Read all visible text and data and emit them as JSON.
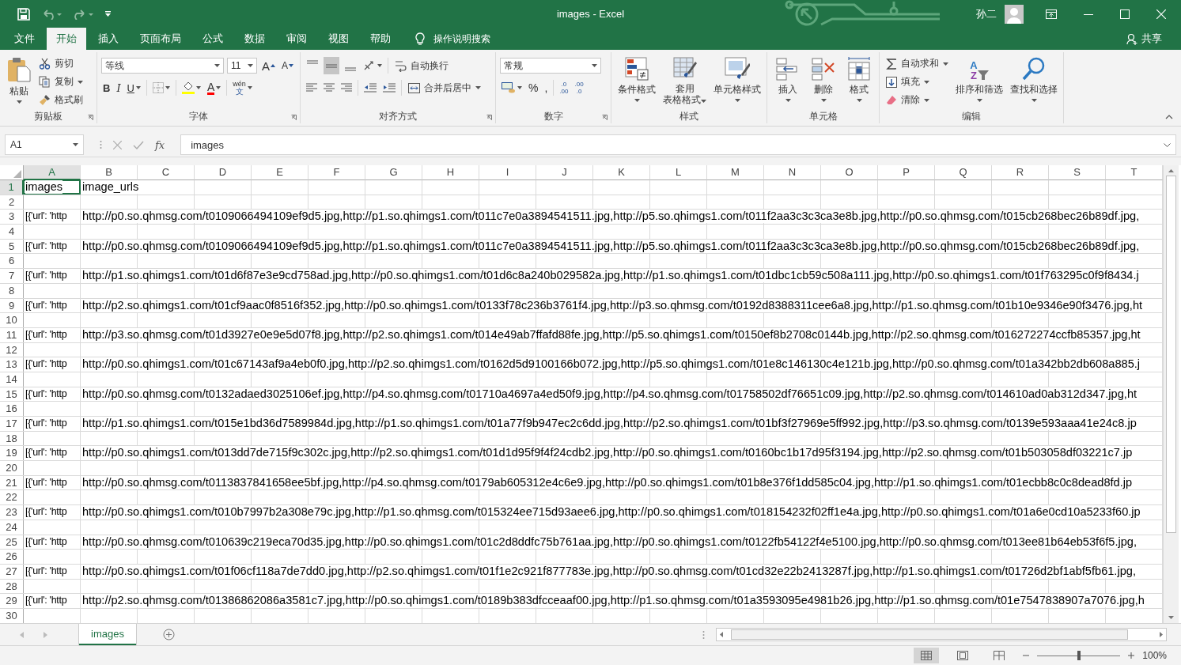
{
  "title_bar": {
    "title": "images  -  Excel",
    "user": "孙二"
  },
  "ribbon_tabs": [
    {
      "label": "文件",
      "selected": false
    },
    {
      "label": "开始",
      "selected": true
    },
    {
      "label": "插入",
      "selected": false
    },
    {
      "label": "页面布局",
      "selected": false
    },
    {
      "label": "公式",
      "selected": false
    },
    {
      "label": "数据",
      "selected": false
    },
    {
      "label": "审阅",
      "selected": false
    },
    {
      "label": "视图",
      "selected": false
    },
    {
      "label": "帮助",
      "selected": false
    }
  ],
  "tell_me": "操作说明搜索",
  "share": "共享",
  "clipboard": {
    "label": "剪贴板",
    "paste": "粘贴",
    "cut": "剪切",
    "copy": "复制",
    "format_painter": "格式刷"
  },
  "font": {
    "label": "字体",
    "font_name": "等线",
    "font_size": "11",
    "grow": "A",
    "shrink": "A",
    "bold": "B",
    "italic": "I",
    "underline": "U",
    "font_color": "A",
    "phonetic_top": "wén",
    "phonetic_bottom": "文"
  },
  "alignment": {
    "label": "对齐方式",
    "wrap_text": "自动换行",
    "merge_center": "合并后居中"
  },
  "number": {
    "label": "数字",
    "format": "常规",
    "percent": "%",
    "comma": ",",
    "increase_decimal": [
      ".0",
      ".00"
    ],
    "decrease_decimal": [
      ".00",
      ".0"
    ]
  },
  "styles": {
    "label": "样式",
    "conditional": "条件格式",
    "table": [
      "套用",
      "表格格式"
    ],
    "cell_styles": "单元格样式"
  },
  "cells": {
    "label": "单元格",
    "buttons": [
      "插入",
      "删除",
      "格式"
    ]
  },
  "editing": {
    "label": "编辑",
    "autosum": "自动求和",
    "fill": "填充",
    "clear": "清除",
    "sort_icon": [
      "A",
      "Z"
    ],
    "sort_filter": "排序和筛选",
    "find_select": "查找和选择"
  },
  "formula_bar": {
    "name_box": "A1",
    "fx": "fx",
    "value": "images"
  },
  "columns": [
    {
      "label": "A",
      "selected": true
    },
    {
      "label": "B",
      "selected": false
    },
    {
      "label": "C",
      "selected": false
    },
    {
      "label": "D",
      "selected": false
    },
    {
      "label": "E",
      "selected": false
    },
    {
      "label": "F",
      "selected": false
    },
    {
      "label": "G",
      "selected": false
    },
    {
      "label": "H",
      "selected": false
    },
    {
      "label": "I",
      "selected": false
    },
    {
      "label": "J",
      "selected": false
    },
    {
      "label": "K",
      "selected": false
    },
    {
      "label": "L",
      "selected": false
    },
    {
      "label": "M",
      "selected": false
    },
    {
      "label": "N",
      "selected": false
    },
    {
      "label": "O",
      "selected": false
    },
    {
      "label": "P",
      "selected": false
    },
    {
      "label": "Q",
      "selected": false
    },
    {
      "label": "R",
      "selected": false
    },
    {
      "label": "S",
      "selected": false
    },
    {
      "label": "T",
      "selected": false
    }
  ],
  "rows": [
    {
      "number": "1",
      "selected": true,
      "cells": [
        "images",
        "image_urls"
      ]
    },
    {
      "number": "2",
      "selected": false,
      "cells": []
    },
    {
      "number": "3",
      "selected": false,
      "cells": [
        "[{'url': 'http",
        "http://p0.so.qhmsg.com/t0109066494109ef9d5.jpg,http://p1.so.qhimgs1.com/t011c7e0a3894541511.jpg,http://p5.so.qhimgs1.com/t011f2aa3c3c3ca3e8b.jpg,http://p0.so.qhmsg.com/t015cb268bec26b89df.jpg,"
      ]
    },
    {
      "number": "4",
      "selected": false,
      "cells": []
    },
    {
      "number": "5",
      "selected": false,
      "cells": [
        "[{'url': 'http",
        "http://p0.so.qhmsg.com/t0109066494109ef9d5.jpg,http://p1.so.qhimgs1.com/t011c7e0a3894541511.jpg,http://p5.so.qhimgs1.com/t011f2aa3c3c3ca3e8b.jpg,http://p0.so.qhmsg.com/t015cb268bec26b89df.jpg,"
      ]
    },
    {
      "number": "6",
      "selected": false,
      "cells": []
    },
    {
      "number": "7",
      "selected": false,
      "cells": [
        "[{'url': 'http",
        "http://p1.so.qhimgs1.com/t01d6f87e3e9cd758ad.jpg,http://p0.so.qhimgs1.com/t01d6c8a240b029582a.jpg,http://p1.so.qhimgs1.com/t01dbc1cb59c508a111.jpg,http://p0.so.qhimgs1.com/t01f763295c0f9f8434.j"
      ]
    },
    {
      "number": "8",
      "selected": false,
      "cells": []
    },
    {
      "number": "9",
      "selected": false,
      "cells": [
        "[{'url': 'http",
        "http://p2.so.qhimgs1.com/t01cf9aac0f8516f352.jpg,http://p0.so.qhimgs1.com/t0133f78c236b3761f4.jpg,http://p3.so.qhmsg.com/t0192d8388311cee6a8.jpg,http://p1.so.qhmsg.com/t01b10e9346e90f3476.jpg,ht"
      ]
    },
    {
      "number": "10",
      "selected": false,
      "cells": []
    },
    {
      "number": "11",
      "selected": false,
      "cells": [
        "[{'url': 'http",
        "http://p3.so.qhmsg.com/t01d3927e0e9e5d07f8.jpg,http://p2.so.qhimgs1.com/t014e49ab7ffafd88fe.jpg,http://p5.so.qhimgs1.com/t0150ef8b2708c0144b.jpg,http://p2.so.qhmsg.com/t016272274ccfb85357.jpg,ht"
      ]
    },
    {
      "number": "12",
      "selected": false,
      "cells": []
    },
    {
      "number": "13",
      "selected": false,
      "cells": [
        "[{'url': 'http",
        "http://p0.so.qhimgs1.com/t01c67143af9a4eb0f0.jpg,http://p2.so.qhimgs1.com/t0162d5d9100166b072.jpg,http://p5.so.qhimgs1.com/t01e8c146130c4e121b.jpg,http://p0.so.qhmsg.com/t01a342bb2db608a885.j"
      ]
    },
    {
      "number": "14",
      "selected": false,
      "cells": []
    },
    {
      "number": "15",
      "selected": false,
      "cells": [
        "[{'url': 'http",
        "http://p0.so.qhmsg.com/t0132adaed3025106ef.jpg,http://p4.so.qhmsg.com/t01710a4697a4ed50f9.jpg,http://p4.so.qhmsg.com/t01758502df76651c09.jpg,http://p2.so.qhmsg.com/t014610ad0ab312d347.jpg,ht"
      ]
    },
    {
      "number": "16",
      "selected": false,
      "cells": []
    },
    {
      "number": "17",
      "selected": false,
      "cells": [
        "[{'url': 'http",
        "http://p1.so.qhimgs1.com/t015e1bd36d7589984d.jpg,http://p1.so.qhimgs1.com/t01a77f9b947ec2c6dd.jpg,http://p2.so.qhimgs1.com/t01bf3f27969e5ff992.jpg,http://p3.so.qhmsg.com/t0139e593aaa41e24c8.jp"
      ]
    },
    {
      "number": "18",
      "selected": false,
      "cells": []
    },
    {
      "number": "19",
      "selected": false,
      "cells": [
        "[{'url': 'http",
        "http://p0.so.qhimgs1.com/t013dd7de715f9c302c.jpg,http://p2.so.qhimgs1.com/t01d1d95f9f4f24cdb2.jpg,http://p0.so.qhimgs1.com/t0160bc1b17d95f3194.jpg,http://p2.so.qhmsg.com/t01b503058df03221c7.jp"
      ]
    },
    {
      "number": "20",
      "selected": false,
      "cells": []
    },
    {
      "number": "21",
      "selected": false,
      "cells": [
        "[{'url': 'http",
        "http://p0.so.qhmsg.com/t0113837841658ee5bf.jpg,http://p4.so.qhmsg.com/t0179ab605312e4c6e9.jpg,http://p0.so.qhimgs1.com/t01b8e376f1dd585c04.jpg,http://p1.so.qhimgs1.com/t01ecbb8c0c8dead8fd.jp"
      ]
    },
    {
      "number": "22",
      "selected": false,
      "cells": []
    },
    {
      "number": "23",
      "selected": false,
      "cells": [
        "[{'url': 'http",
        "http://p0.so.qhimgs1.com/t010b7997b2a308e79c.jpg,http://p1.so.qhmsg.com/t015324ee715d93aee6.jpg,http://p0.so.qhimgs1.com/t018154232f02ff1e4a.jpg,http://p0.so.qhimgs1.com/t01a6e0cd10a5233f60.jp"
      ]
    },
    {
      "number": "24",
      "selected": false,
      "cells": []
    },
    {
      "number": "25",
      "selected": false,
      "cells": [
        "[{'url': 'http",
        "http://p0.so.qhmsg.com/t010639c219eca70d35.jpg,http://p0.so.qhimgs1.com/t01c2d8ddfc75b761aa.jpg,http://p0.so.qhimgs1.com/t0122fb54122f4e5100.jpg,http://p0.so.qhmsg.com/t013ee81b64eb53f6f5.jpg,"
      ]
    },
    {
      "number": "26",
      "selected": false,
      "cells": []
    },
    {
      "number": "27",
      "selected": false,
      "cells": [
        "[{'url': 'http",
        "http://p0.so.qhimgs1.com/t01f06cf118a7de7dd0.jpg,http://p2.so.qhimgs1.com/t01f1e2c921f877783e.jpg,http://p0.so.qhmsg.com/t01cd32e22b2413287f.jpg,http://p1.so.qhimgs1.com/t01726d2bf1abf5fb61.jpg,"
      ]
    },
    {
      "number": "28",
      "selected": false,
      "cells": []
    },
    {
      "number": "29",
      "selected": false,
      "cells": [
        "[{'url': 'http",
        "http://p2.so.qhmsg.com/t01386862086a3581c7.jpg,http://p0.so.qhimgs1.com/t0189b383dfcceaaf00.jpg,http://p1.so.qhmsg.com/t01a3593095e4981b26.jpg,http://p1.so.qhmsg.com/t01e7547838907a7076.jpg,h"
      ]
    },
    {
      "number": "30",
      "selected": false,
      "cells": []
    }
  ],
  "sheet_tabs": [
    {
      "label": "images",
      "selected": true
    }
  ],
  "status_bar": {
    "zoom": "100%",
    "level": 0.5,
    "views": [
      {
        "kind": "normal",
        "selected": true
      },
      {
        "kind": "page_layout",
        "selected": false
      },
      {
        "kind": "page_break",
        "selected": false
      }
    ]
  }
}
